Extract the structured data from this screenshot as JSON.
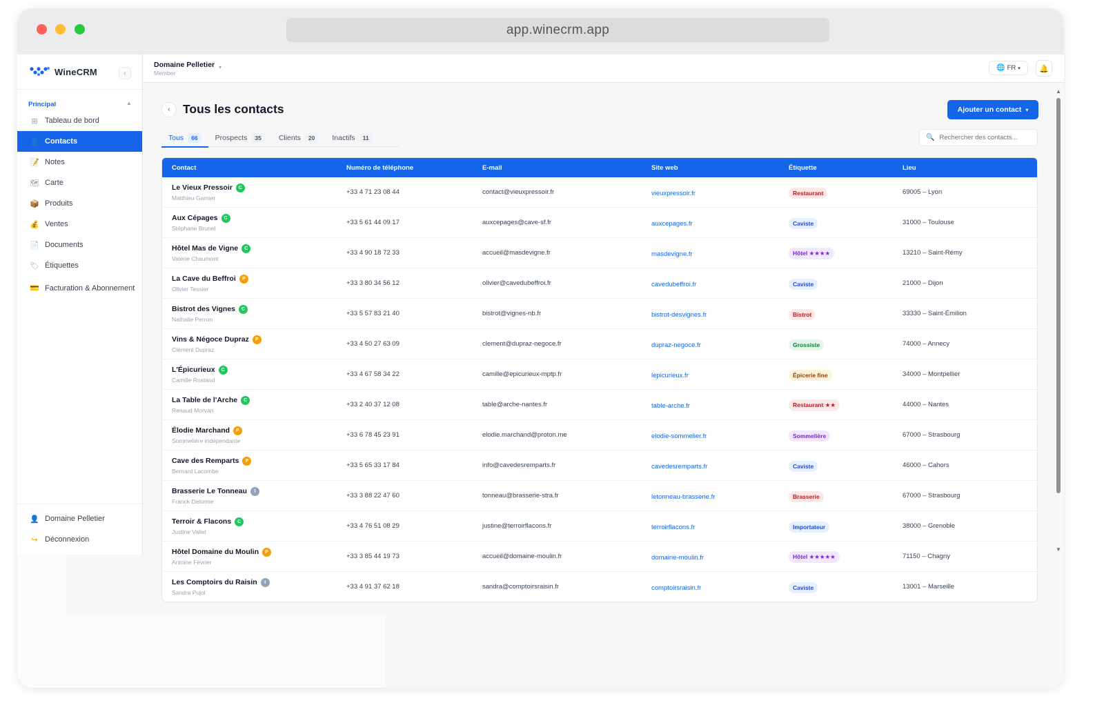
{
  "browser": {
    "url": "app.winecrm.app"
  },
  "brand": {
    "name": "WineCRM",
    "colors": {
      "primary": "#1565e8",
      "logo": "#1565e8"
    }
  },
  "sidebar": {
    "section_label": "Principal",
    "items": [
      {
        "label": "Tableau de bord",
        "icon": "grid-icon",
        "glyph": "⊞"
      },
      {
        "label": "Contacts",
        "icon": "user-icon",
        "glyph": "👤",
        "active": true
      },
      {
        "label": "Notes",
        "icon": "note-icon",
        "glyph": "📝"
      },
      {
        "label": "Carte",
        "icon": "map-icon",
        "glyph": "🗺"
      },
      {
        "label": "Produits",
        "icon": "box-icon",
        "glyph": "📦"
      },
      {
        "label": "Ventes",
        "icon": "money-bag-icon",
        "glyph": "💰"
      },
      {
        "label": "Documents",
        "icon": "document-icon",
        "glyph": "📄"
      },
      {
        "label": "Étiquettes",
        "icon": "tag-icon",
        "glyph": "🏷"
      },
      {
        "label": "Facturation & Abonnement",
        "icon": "credit-card-icon",
        "glyph": "💳"
      }
    ],
    "bottom": [
      {
        "label": "Domaine Pelletier",
        "icon": "user-icon",
        "glyph": "👤"
      },
      {
        "label": "Déconnexion",
        "icon": "logout-icon",
        "glyph": "↪"
      }
    ]
  },
  "topbar": {
    "org_name": "Domaine Pelletier",
    "org_role": "Member",
    "language": "FR"
  },
  "page": {
    "title": "Tous les contacts",
    "add_button": "Ajouter un contact",
    "search_placeholder": "Rechercher des contacts...",
    "tabs": [
      {
        "label": "Tous",
        "count": "66",
        "active": true
      },
      {
        "label": "Prospects",
        "count": "35"
      },
      {
        "label": "Clients",
        "count": "20"
      },
      {
        "label": "Inactifs",
        "count": "11"
      }
    ]
  },
  "table": {
    "columns": [
      "Contact",
      "Numéro de téléphone",
      "E-mail",
      "Site web",
      "Étiquette",
      "Lieu"
    ],
    "status_colors": {
      "C": "#22c55e",
      "P": "#f59e0b",
      "I": "#94a3b8"
    },
    "rows": [
      {
        "name": "Le Vieux Pressoir",
        "person": "Matthieu Garnier",
        "status": "C",
        "phone": "+33 4 71 23 08 44",
        "email": "contact@vieuxpressoir.fr",
        "web": "vieuxpressoir.fr",
        "tag": "Restaurant",
        "tag_bg": "#fde8e8",
        "tag_fg": "#b91c1c",
        "place": "69005 – Lyon"
      },
      {
        "name": "Aux Cépages",
        "person": "Stéphane Brunel",
        "status": "C",
        "phone": "+33 5 61 44 09 17",
        "email": "auxcepages@cave-sf.fr",
        "web": "auxcepages.fr",
        "tag": "Caviste",
        "tag_bg": "#e6efff",
        "tag_fg": "#1d4ed8",
        "place": "31000 – Toulouse"
      },
      {
        "name": "Hôtel Mas de Vigne",
        "person": "Valérie Chaumont",
        "status": "C",
        "phone": "+33 4 90 18 72 33",
        "email": "accueil@masdevigne.fr",
        "web": "masdevigne.fr",
        "tag": "Hôtel ★★★★",
        "tag_bg": "#f1e8fd",
        "tag_fg": "#7e22ce",
        "place": "13210 – Saint-Rémy"
      },
      {
        "name": "La Cave du Beffroi",
        "person": "Olivier Tessier",
        "status": "P",
        "phone": "+33 3 80 34 56 12",
        "email": "olivier@cavedubeffroi.fr",
        "web": "cavedubeffroi.fr",
        "tag": "Caviste",
        "tag_bg": "#e6efff",
        "tag_fg": "#1d4ed8",
        "place": "21000 – Dijon"
      },
      {
        "name": "Bistrot des Vignes",
        "person": "Nathalie Perron",
        "status": "C",
        "phone": "+33 5 57 83 21 40",
        "email": "bistrot@vignes-nb.fr",
        "web": "bistrot-desvignes.fr",
        "tag": "Bistrot",
        "tag_bg": "#fde8e8",
        "tag_fg": "#b91c1c",
        "place": "33330 – Saint-Émilion"
      },
      {
        "name": "Vins & Négoce Dupraz",
        "person": "Clément Dupraz",
        "status": "P",
        "phone": "+33 4 50 27 63 09",
        "email": "clement@dupraz-negoce.fr",
        "web": "dupraz-negoce.fr",
        "tag": "Grossiste",
        "tag_bg": "#e3f7ec",
        "tag_fg": "#15803d",
        "place": "74000 – Annecy"
      },
      {
        "name": "L'Épicurieux",
        "person": "Camille Rostand",
        "status": "C",
        "phone": "+33 4 67 58 34 22",
        "email": "camille@epicurieux-mptp.fr",
        "web": "lepicurieux.fr",
        "tag": "Épicerie fine",
        "tag_bg": "#fdf3d6",
        "tag_fg": "#92400e",
        "place": "34000 – Montpellier"
      },
      {
        "name": "La Table de l'Arche",
        "person": "Renaud Morvan",
        "status": "C",
        "phone": "+33 2 40 37 12 08",
        "email": "table@arche-nantes.fr",
        "web": "table-arche.fr",
        "tag": "Restaurant ★★",
        "tag_bg": "#fde8e8",
        "tag_fg": "#b91c1c",
        "place": "44000 – Nantes"
      },
      {
        "name": "Élodie Marchand",
        "person": "Sommelière indépendante",
        "status": "P",
        "phone": "+33 6 78 45 23 91",
        "email": "elodie.marchand@proton.me",
        "web": "elodie-sommelier.fr",
        "tag": "Sommelière",
        "tag_bg": "#f1e8fd",
        "tag_fg": "#7e22ce",
        "place": "67000 – Strasbourg"
      },
      {
        "name": "Cave des Remparts",
        "person": "Bernard Lacombe",
        "status": "P",
        "phone": "+33 5 65 33 17 84",
        "email": "info@cavedesremparts.fr",
        "web": "cavedesremparts.fr",
        "tag": "Caviste",
        "tag_bg": "#e6efff",
        "tag_fg": "#1d4ed8",
        "place": "46000 – Cahors"
      },
      {
        "name": "Brasserie Le Tonneau",
        "person": "Franck Delorme",
        "status": "I",
        "phone": "+33 3 88 22 47 60",
        "email": "tonneau@brasserie-stra.fr",
        "web": "letonneau-brasserie.fr",
        "tag": "Brasserie",
        "tag_bg": "#fde8e8",
        "tag_fg": "#b91c1c",
        "place": "67000 – Strasbourg"
      },
      {
        "name": "Terroir & Flacons",
        "person": "Justine Vallet",
        "status": "C",
        "phone": "+33 4 76 51 08 29",
        "email": "justine@terroirflacons.fr",
        "web": "terroirflacons.fr",
        "tag": "Importateur",
        "tag_bg": "#e6efff",
        "tag_fg": "#1d4ed8",
        "place": "38000 – Grenoble"
      },
      {
        "name": "Hôtel Domaine du Moulin",
        "person": "Antoine Février",
        "status": "P",
        "phone": "+33 3 85 44 19 73",
        "email": "accueil@domaine-moulin.fr",
        "web": "domaine-moulin.fr",
        "tag": "Hôtel ★★★★★",
        "tag_bg": "#f1e8fd",
        "tag_fg": "#7e22ce",
        "place": "71150 – Chagny"
      },
      {
        "name": "Les Comptoirs du Raisin",
        "person": "Sandra Pujol",
        "status": "I",
        "phone": "+33 4 91 37 62 18",
        "email": "sandra@comptoirsraisin.fr",
        "web": "comptoirsraisin.fr",
        "tag": "Caviste",
        "tag_bg": "#e6efff",
        "tag_fg": "#1d4ed8",
        "place": "13001 – Marseille"
      }
    ]
  }
}
